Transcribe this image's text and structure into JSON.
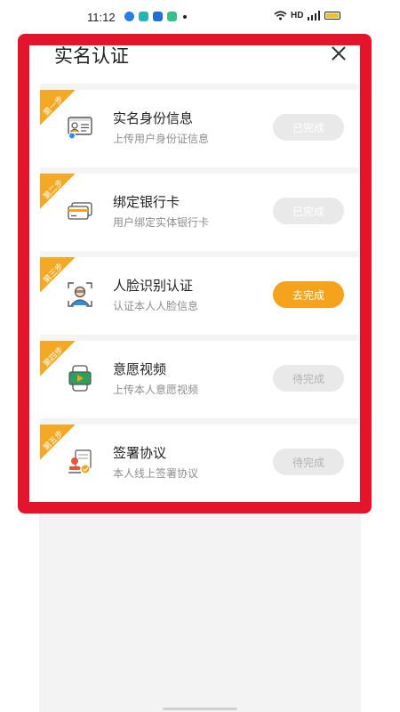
{
  "status_bar": {
    "time": "11:12",
    "network": "HD"
  },
  "sheet": {
    "title": "实名认证"
  },
  "steps": [
    {
      "badge": "第一步",
      "name": "实名身份信息",
      "desc": "上传用户身份证信息",
      "button": "已完成",
      "icon": "id-card-icon",
      "state": "done"
    },
    {
      "badge": "第二步",
      "name": "绑定银行卡",
      "desc": "用户绑定实体银行卡",
      "button": "已完成",
      "icon": "bank-card-icon",
      "state": "done"
    },
    {
      "badge": "第三步",
      "name": "人脸识别认证",
      "desc": "认证本人人脸信息",
      "button": "去完成",
      "icon": "face-scan-icon",
      "state": "action"
    },
    {
      "badge": "第四步",
      "name": "意愿视频",
      "desc": "上传本人意愿视频",
      "button": "待完成",
      "icon": "video-icon",
      "state": "pending"
    },
    {
      "badge": "第五步",
      "name": "签署协议",
      "desc": "本人线上签署协议",
      "button": "待完成",
      "icon": "signature-icon",
      "state": "pending"
    }
  ],
  "colors": {
    "accent": "#f5a21c",
    "highlight_frame": "#e4142c"
  }
}
